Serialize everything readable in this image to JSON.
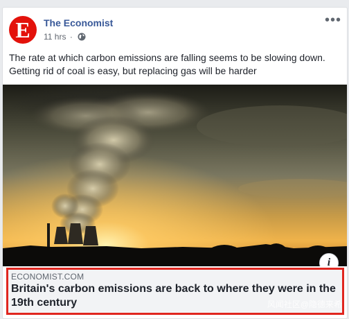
{
  "post": {
    "page_name": "The Economist",
    "avatar_letter": "E",
    "timestamp": "11 hrs",
    "separator": "·",
    "privacy_icon": "globe-icon",
    "more_label": "•••",
    "text": "The rate at which carbon emissions are falling seems to be slowing down. Getting rid of coal is easy, but replacing gas will be harder"
  },
  "photo": {
    "alt_icon": "info-icon",
    "info_label": "i"
  },
  "link_preview": {
    "domain": "ECONOMIST.COM",
    "title": "Britain's carbon emissions are back to where they were in the 19th century"
  },
  "watermark": "风闻社区@隐德来希",
  "colors": {
    "brand_red": "#e3120b",
    "page_name": "#385898",
    "highlight_border": "#e0261f"
  }
}
